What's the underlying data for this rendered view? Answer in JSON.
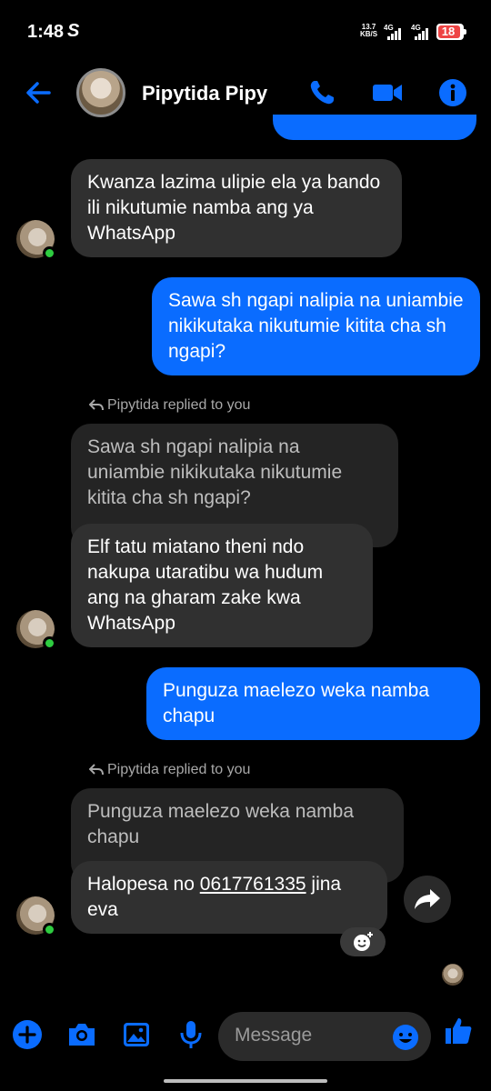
{
  "status": {
    "time": "1:48",
    "app_icon": "S",
    "net_speed_value": "13.7",
    "net_speed_unit": "KB/S",
    "signal1": "4G",
    "signal2": "4G",
    "battery": "18"
  },
  "header": {
    "contact_name": "Pipytida Pipy",
    "icons": [
      "back-arrow-icon",
      "phone-icon",
      "video-icon",
      "info-icon"
    ],
    "accent": "#0a6cff"
  },
  "messages": [
    {
      "from": "them",
      "text": "Kwanza lazima ulipie ela ya bando ili nikutumie namba ang ya WhatsApp"
    },
    {
      "from": "me",
      "text": "Sawa sh ngapi nalipia na uniambie nikikutaka nikutumie kititа cha sh ngapi?"
    },
    {
      "from": "them",
      "reply_label": "Pipytida replied to you",
      "quoted": "Sawa sh ngapi nalipia na uniambie nikikutaka nikutumie kitita cha sh ngapi?",
      "text": "Elf tatu miatano theni ndo nakupa utaratibu wa hudum ang na gharam zake kwa WhatsApp"
    },
    {
      "from": "me",
      "text": "Punguza maelezo weka namba chapu"
    },
    {
      "from": "them",
      "reply_label": "Pipytida replied to you",
      "quoted": "Punguza maelezo weka namba chapu",
      "text_prefix": "Halopesa no ",
      "phone": "0617761335",
      "text_suffix": " jina eva"
    }
  ],
  "composer": {
    "placeholder": "Message",
    "icons": [
      "plus-icon",
      "camera-icon",
      "gallery-icon",
      "mic-icon",
      "emoji-icon",
      "like-icon"
    ]
  }
}
